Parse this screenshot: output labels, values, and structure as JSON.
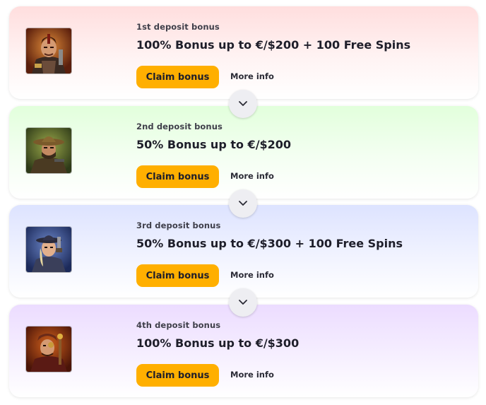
{
  "bonuses": [
    {
      "label": "1st deposit bonus",
      "title": "100% Bonus up to €/$200 + 100 Free Spins",
      "claim": "Claim bonus",
      "more": "More info",
      "icon": "warrior-character-icon",
      "tint": "#ffdede"
    },
    {
      "label": "2nd deposit bonus",
      "title": "50% Bonus up to €/$200",
      "claim": "Claim bonus",
      "more": "More info",
      "icon": "cowboy-character-icon",
      "tint": "#e2ffdc"
    },
    {
      "label": "3rd deposit bonus",
      "title": "50% Bonus up to €/$300 + 100 Free Spins",
      "claim": "Claim bonus",
      "more": "More info",
      "icon": "gunslinger-character-icon",
      "tint": "#dde3ff"
    },
    {
      "label": "4th deposit bonus",
      "title": "100% Bonus up to €/$300",
      "claim": "Claim bonus",
      "more": "More info",
      "icon": "pirate-character-icon",
      "tint": "#ecdcff"
    }
  ],
  "colors": {
    "button": "#ffaf00",
    "text": "#1e1e2a"
  }
}
